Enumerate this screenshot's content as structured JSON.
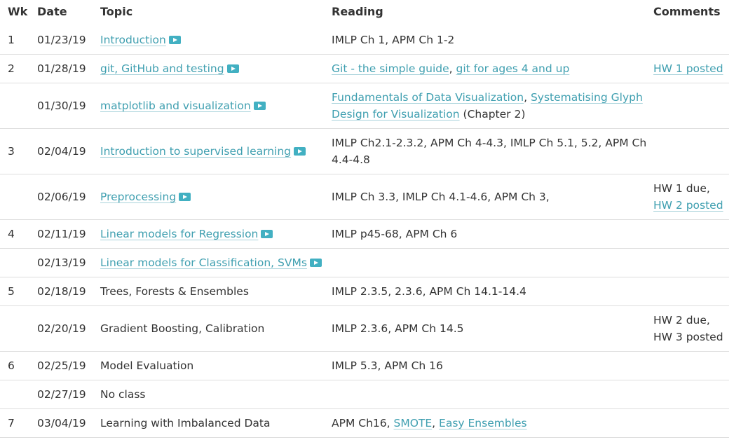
{
  "headers": {
    "wk": "Wk",
    "date": "Date",
    "topic": "Topic",
    "reading": "Reading",
    "comments": "Comments"
  },
  "colors": {
    "link": "#3f9fb0",
    "video_icon": "#42b0c2",
    "rule": "#dddddd",
    "text": "#333333"
  },
  "rows": [
    {
      "wk": "1",
      "date": "01/23/19",
      "topic": "Introduction",
      "reading": {
        "t1": "IMLP Ch 1, APM Ch 1-2"
      }
    },
    {
      "wk": "2",
      "date": "01/28/19",
      "topic": "git, GitHub and testing",
      "reading": {
        "l1": "Git - the simple guide",
        "sep": ", ",
        "l2": "git for ages 4 and up"
      },
      "comments": {
        "l1": "HW 1 posted"
      }
    },
    {
      "wk": "",
      "date": "01/30/19",
      "topic": "matplotlib and visualization",
      "reading": {
        "l1": "Fundamentals of Data Visualization",
        "sep": ", ",
        "l2": "Systematising Glyph Design for Visualization",
        "t2": " (Chapter 2)"
      }
    },
    {
      "wk": "3",
      "date": "02/04/19",
      "topic": "Introduction to supervised learning",
      "reading": {
        "t1": "IMLP Ch2.1-2.3.2, APM Ch 4-4.3, IMLP Ch 5.1, 5.2, APM Ch 4.4-4.8"
      }
    },
    {
      "wk": "",
      "date": "02/06/19",
      "topic": "Preprocessing",
      "reading": {
        "t1": "IMLP Ch 3.3, IMLP Ch 4.1-4.6, APM Ch 3,"
      },
      "comments": {
        "t1": "HW 1 due,",
        "l1": "HW 2 posted"
      }
    },
    {
      "wk": "4",
      "date": "02/11/19",
      "topic": "Linear models for Regression",
      "reading": {
        "t1": "IMLP p45-68, APM Ch 6"
      }
    },
    {
      "wk": "",
      "date": "02/13/19",
      "topic": "Linear models for Classification, SVMs",
      "reading": {}
    },
    {
      "wk": "5",
      "date": "02/18/19",
      "topic": "Trees, Forests & Ensembles",
      "reading": {
        "t1": "IMLP 2.3.5, 2.3.6, APM Ch 14.1-14.4"
      }
    },
    {
      "wk": "",
      "date": "02/20/19",
      "topic": "Gradient Boosting, Calibration",
      "reading": {
        "t1": "IMLP 2.3.6, APM Ch 14.5"
      },
      "comments": {
        "t1": "HW 2 due,",
        "t2": "HW 3 posted"
      }
    },
    {
      "wk": "6",
      "date": "02/25/19",
      "topic": "Model Evaluation",
      "reading": {
        "t1": "IMLP 5.3, APM Ch 16"
      }
    },
    {
      "wk": "",
      "date": "02/27/19",
      "topic": "No class",
      "reading": {}
    },
    {
      "wk": "7",
      "date": "03/04/19",
      "topic": "Learning with Imbalanced Data",
      "reading": {
        "t1": "APM Ch16, ",
        "l1": "SMOTE",
        "sep": ", ",
        "l2": "Easy Ensembles"
      }
    }
  ]
}
